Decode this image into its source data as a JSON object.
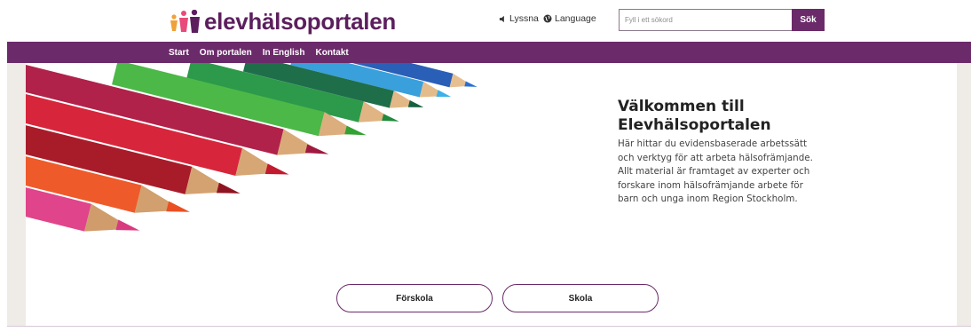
{
  "header": {
    "logo_text": "elevhälsoportalen",
    "logo_icon": "people-figures-icon",
    "listen_label": "Lyssna",
    "language_label": "Language",
    "search_placeholder": "Fyll i ett sökord",
    "search_button": "Sök"
  },
  "nav": {
    "items": [
      "Start",
      "Om portalen",
      "In English",
      "Kontakt"
    ]
  },
  "hero": {
    "title_line1": "Välkommen till",
    "title_line2": "Elevhälsoportalen",
    "text": "Här hittar du evidensbaserade arbetssätt och verktyg för att arbeta hälsofrämjande. Allt material är framtaget av experter och forskare inom hälsofrämjande arbete för barn och unga inom Region Stockholm.",
    "image": "colored-pencils"
  },
  "buttons": {
    "preschool": "Förskola",
    "school": "Skola"
  },
  "colors": {
    "brand": "#6b2a6a",
    "logo": "#5c1f5e",
    "side_strip": "#efece7"
  }
}
